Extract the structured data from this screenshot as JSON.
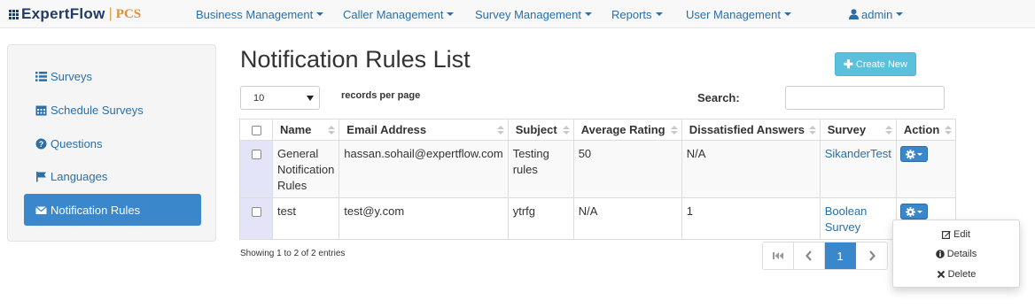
{
  "brand": {
    "name": "ExpertFlow",
    "separator": "|",
    "product": "PCS"
  },
  "nav": {
    "menus": [
      {
        "label": "Business Management"
      },
      {
        "label": "Caller Management"
      },
      {
        "label": "Survey Management"
      },
      {
        "label": "Reports"
      },
      {
        "label": "User Management"
      }
    ],
    "user": "admin"
  },
  "sidebar": {
    "items": [
      {
        "label": "Surveys",
        "icon": "list-icon"
      },
      {
        "label": "Schedule Surveys",
        "icon": "calendar-icon"
      },
      {
        "label": "Questions",
        "icon": "question-circle-icon"
      },
      {
        "label": "Languages",
        "icon": "flag-icon"
      },
      {
        "label": "Notification Rules",
        "icon": "envelope-icon",
        "active": true
      }
    ]
  },
  "main": {
    "title": "Notification Rules List",
    "create_button": "Create New",
    "page_length": "10",
    "page_length_label": "records per page",
    "search_label": "Search:",
    "search_value": ""
  },
  "table": {
    "columns": [
      "Name",
      "Email Address",
      "Subject",
      "Average Rating",
      "Dissatisfied Answers",
      "Survey",
      "Action"
    ],
    "rows": [
      {
        "name": "General Notification Rules",
        "email": "hassan.sohail@expertflow.com",
        "subject": "Testing rules",
        "average_rating": "50",
        "dissatisfied_answers": "N/A",
        "survey": "SikanderTest"
      },
      {
        "name": "test",
        "email": "test@y.com",
        "subject": "ytrfg",
        "average_rating": "N/A",
        "dissatisfied_answers": "1",
        "survey": "Boolean Survey"
      }
    ],
    "info": "Showing 1 to 2 of 2 entries"
  },
  "pagination": {
    "current": "1"
  },
  "action_menu": {
    "items": [
      "Edit",
      "Details",
      "Delete"
    ]
  },
  "colors": {
    "primary": "#3a87cc",
    "info": "#5bc0de",
    "link": "#2a6fa8",
    "brand": "#1f3b66",
    "brand_accent": "#e58f2d"
  }
}
